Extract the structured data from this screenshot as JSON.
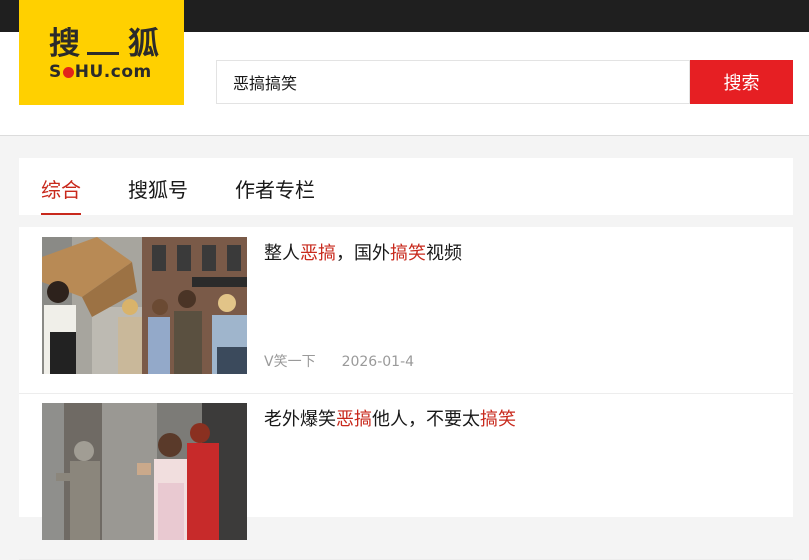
{
  "logo": {
    "cn_left": "搜",
    "cn_right": "狐",
    "en_pre": "S",
    "en_mid": "HU.com"
  },
  "search": {
    "value": "恶搞搞笑",
    "button_label": "搜索"
  },
  "tabs": [
    {
      "label": "综合",
      "active": true
    },
    {
      "label": "搜狐号",
      "active": false
    },
    {
      "label": "作者专栏",
      "active": false
    }
  ],
  "results": [
    {
      "title_parts": [
        "整人",
        "恶搞",
        "，国外",
        "搞笑",
        "视频"
      ],
      "author": "V笑一下",
      "date": "2026-01-4"
    },
    {
      "title_parts": [
        "老外爆笑",
        "恶搞",
        "他人，不要太",
        "搞笑"
      ],
      "author": "",
      "date": ""
    }
  ],
  "colors": {
    "accent": "#e61f23",
    "highlight": "#c8291c",
    "logo_bg": "#ffd000",
    "topbar": "#1f1f1f"
  }
}
